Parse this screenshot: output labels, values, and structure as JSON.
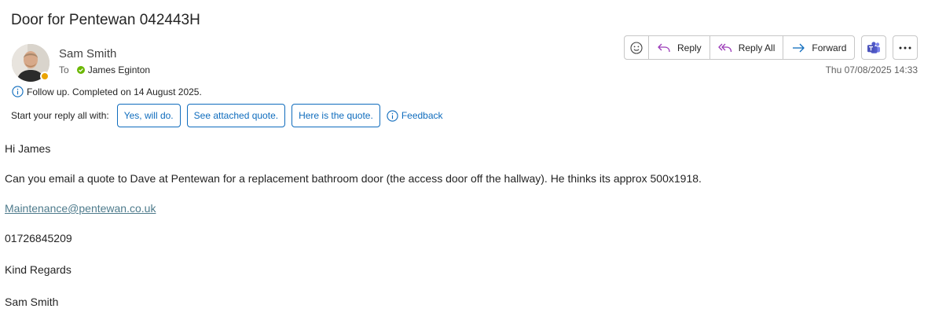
{
  "message": {
    "subject": "Door for Pentewan 042443H",
    "sender": "Sam Smith",
    "to_label": "To",
    "recipient": "James Eginton",
    "date": "Thu 07/08/2025 14:33",
    "followup": "Follow up.  Completed on 14 August 2025."
  },
  "toolbar": {
    "reply": "Reply",
    "reply_all": "Reply All",
    "forward": "Forward"
  },
  "suggestions": {
    "label": "Start your reply all with:",
    "chips": [
      "Yes, will do.",
      "See attached quote.",
      "Here is the quote."
    ],
    "feedback": "Feedback"
  },
  "body": {
    "greeting": "Hi James",
    "line1": "Can you email a quote to Dave at Pentewan for a replacement bathroom door (the access door off the hallway). He thinks its approx 500x1918.",
    "email": "Maintenance@pentewan.co.uk",
    "phone": "01726845209",
    "closing": "Kind Regards",
    "signature": "Sam Smith"
  },
  "colors": {
    "accent": "#0f6cbd",
    "reply_all_icon": "#9b3ab8",
    "presence_away": "#eaa300",
    "accepted": "#6bb700",
    "link": "#4e7b8c"
  }
}
